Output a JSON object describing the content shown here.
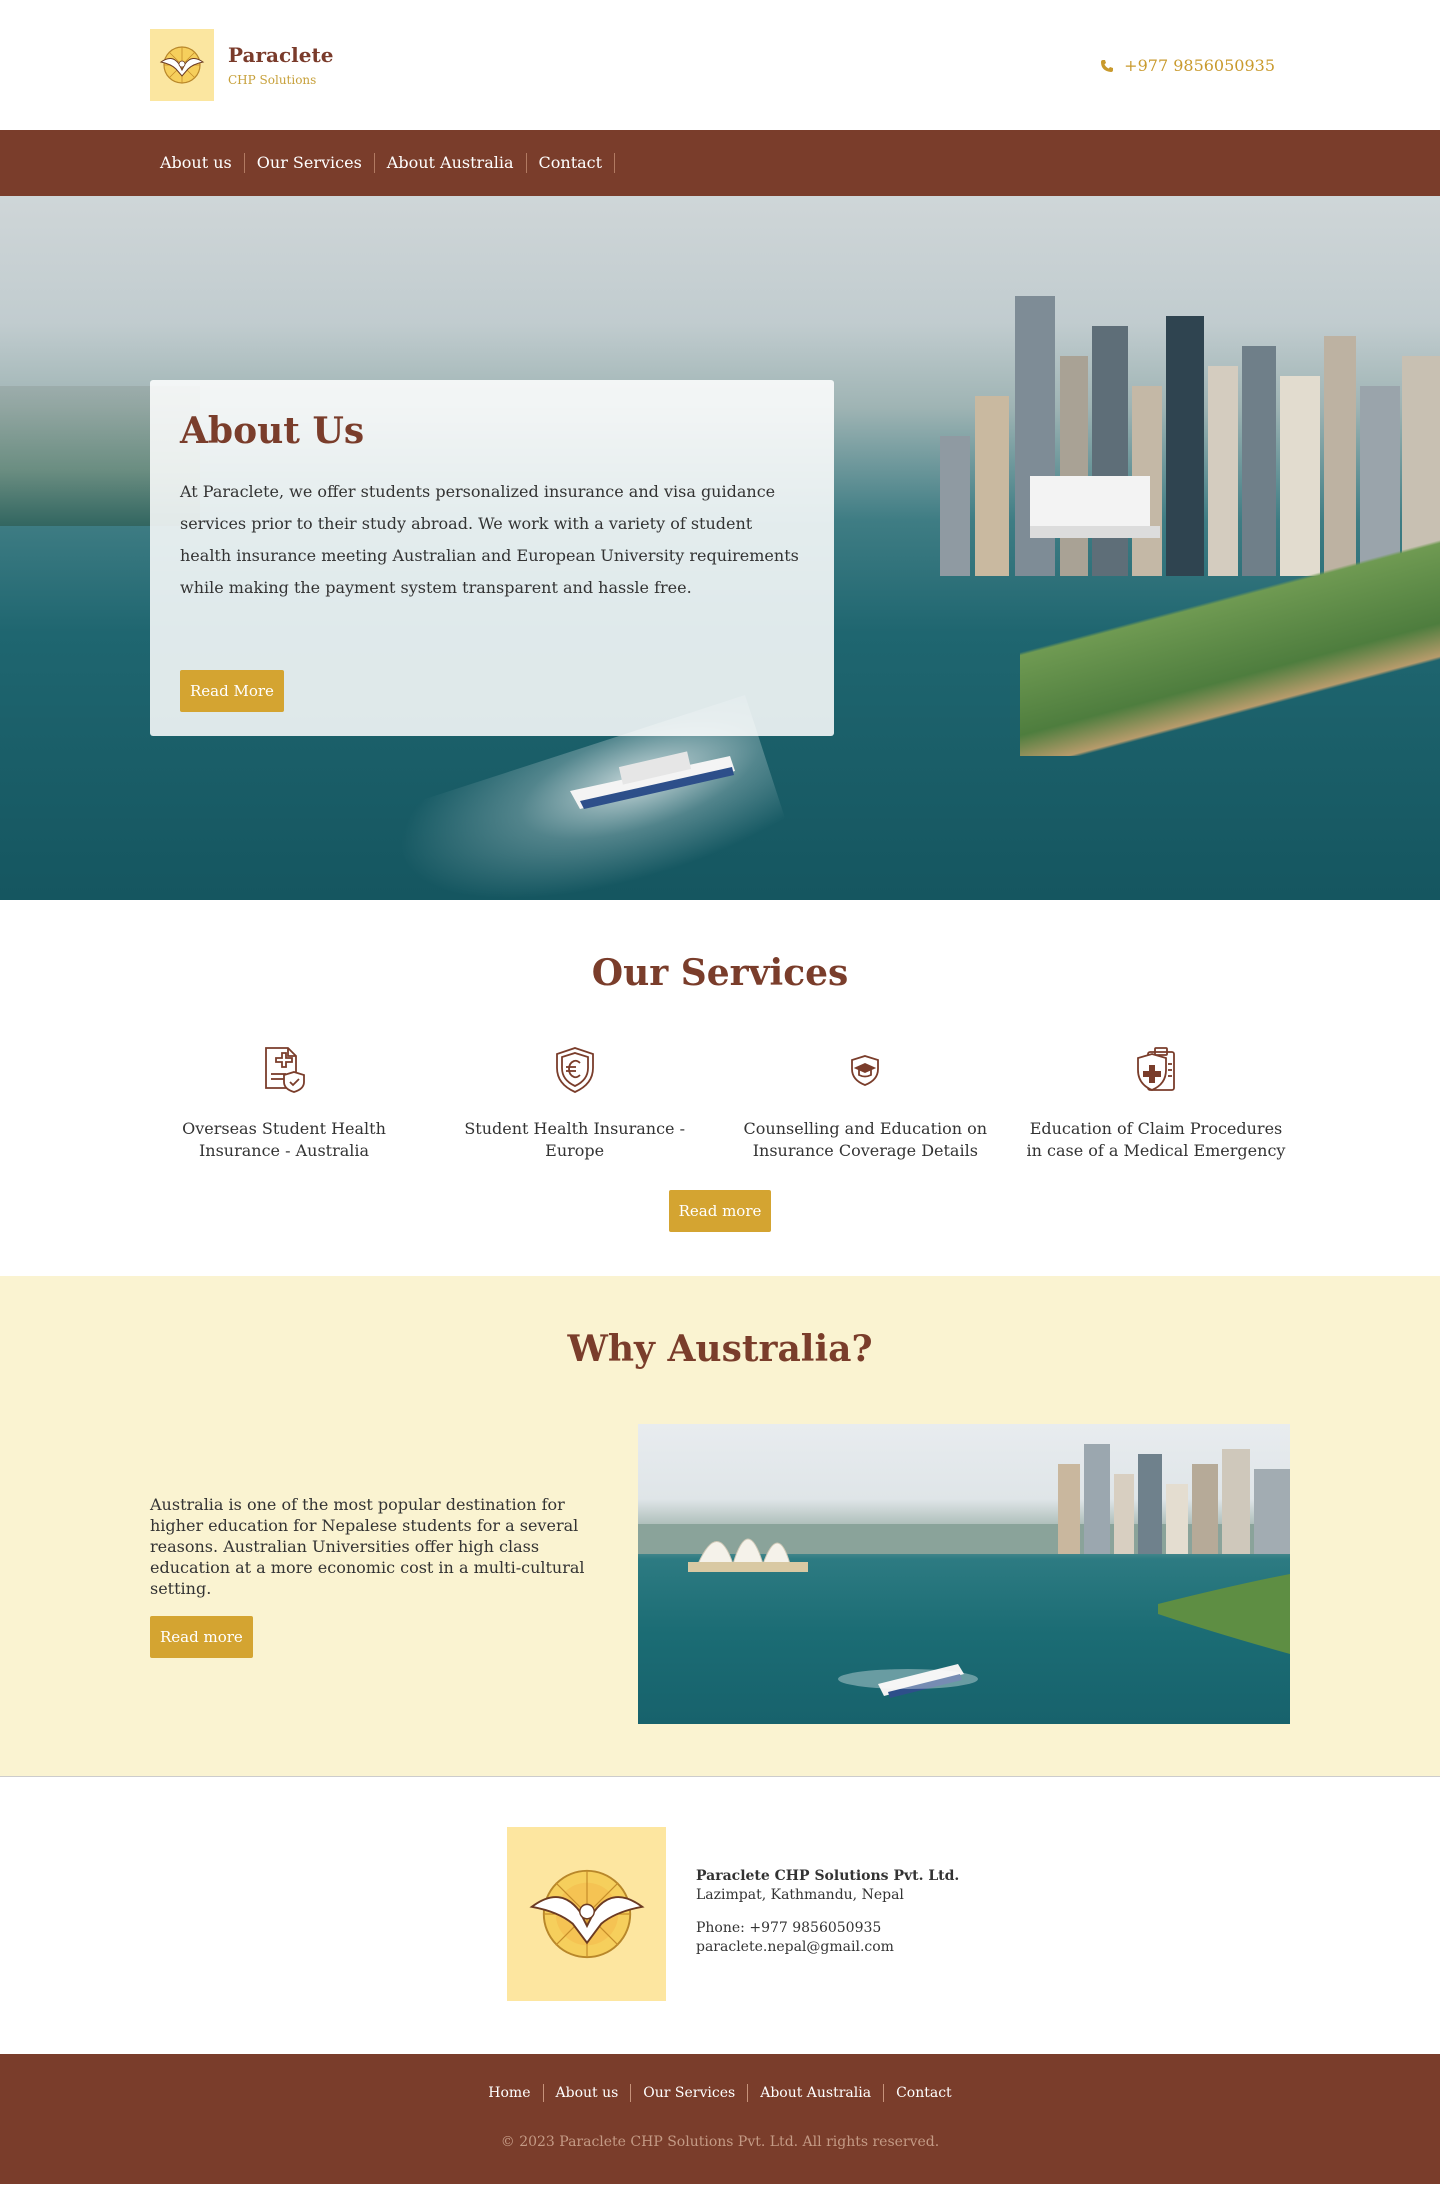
{
  "header": {
    "brand_name": "Paraclete",
    "brand_sub": "CHP Solutions",
    "phone": "+977 9856050935",
    "logo_icon": "dove-logo",
    "phone_icon": "phone-icon",
    "accent_color": "#c99a2d"
  },
  "nav": {
    "items": [
      "About us",
      "Our Services",
      "About Australia",
      "Contact"
    ],
    "bg_color": "#7a3d2b"
  },
  "hero": {
    "title": "About Us",
    "text": "At Paraclete, we offer students personalized insurance and visa guidance services prior to their study abroad. We work with a variety of student health insurance meeting Australian and European University requirements while making the payment system transparent and hassle free.",
    "button": "Read More"
  },
  "services": {
    "title": "Our Services",
    "items": [
      {
        "label": "Overseas Student Health Insurance - Australia",
        "icon": "health-document-icon"
      },
      {
        "label": "Student Health Insurance - Europe",
        "icon": "euro-shield-icon"
      },
      {
        "label": "Counselling and Education on Insurance Coverage Details",
        "icon": "graduate-shield-icon"
      },
      {
        "label": "Education of Claim Procedures in case of a Medical Emergency",
        "icon": "medical-claim-icon"
      }
    ],
    "button": "Read more"
  },
  "why": {
    "title": "Why Australia?",
    "text": "Australia is one of the most popular destination for higher education for Nepalese students for a several reasons. Australian Universities offer high class education at a more economic cost in a multi-cultural setting.",
    "button": "Read more",
    "bg_color": "#faf3d1"
  },
  "contact": {
    "company": "Paraclete CHP Solutions Pvt. Ltd.",
    "address": "Lazimpat, Kathmandu, Nepal",
    "phone": "Phone: +977 9856050935",
    "email": "paraclete.nepal@gmail.com"
  },
  "footer": {
    "items": [
      "Home",
      "About us",
      "Our Services",
      "About Australia",
      "Contact"
    ],
    "copyright": "© 2023 Paraclete CHP Solutions Pvt. Ltd. All rights reserved."
  },
  "colors": {
    "brown": "#7a3d2b",
    "gold": "#d4a431"
  }
}
